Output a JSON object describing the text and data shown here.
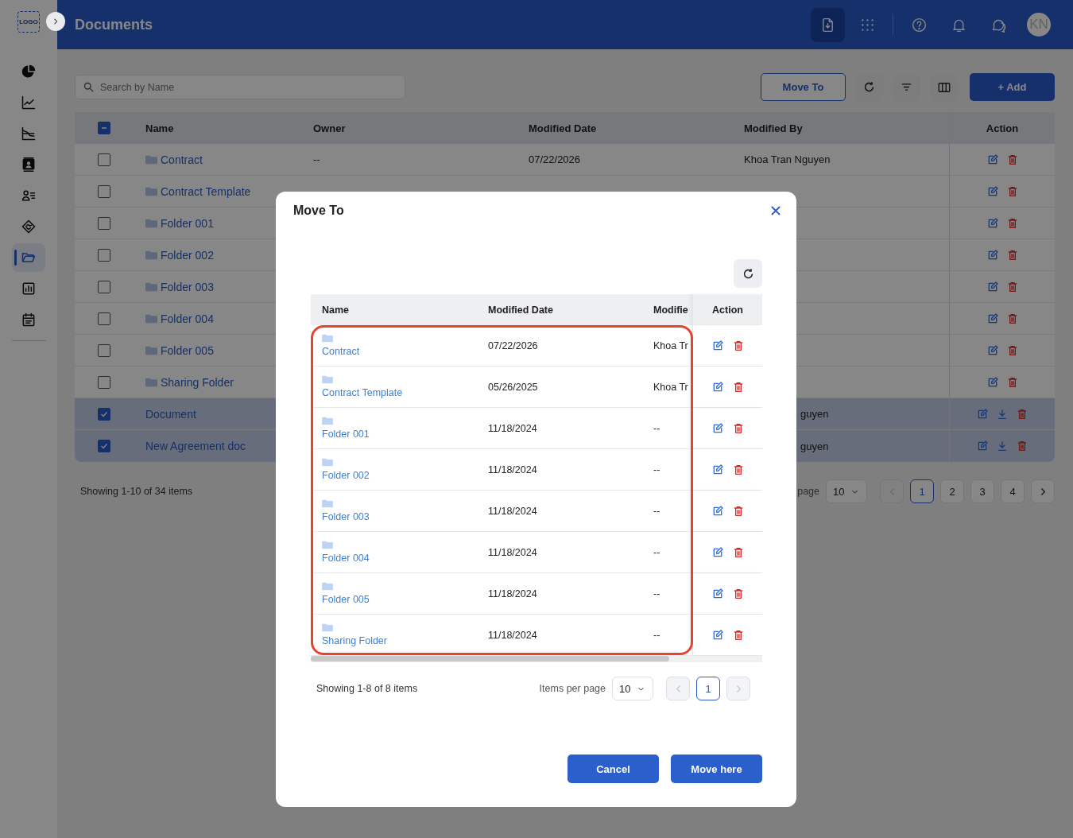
{
  "sidebar": {
    "logo": "LOGO",
    "items": [
      {
        "kind": "pie",
        "selected": false
      },
      {
        "kind": "line",
        "selected": false
      },
      {
        "kind": "trend",
        "selected": false
      },
      {
        "kind": "contacts",
        "selected": false
      },
      {
        "kind": "people",
        "selected": false
      },
      {
        "kind": "deal",
        "selected": false
      },
      {
        "kind": "folder",
        "selected": true
      },
      {
        "kind": "report",
        "selected": false
      },
      {
        "kind": "calendar",
        "selected": false
      }
    ]
  },
  "header": {
    "title": "Documents",
    "avatar": "KN",
    "actions": [
      {
        "kind": "download",
        "selected": true
      },
      {
        "kind": "apps",
        "selected": false
      },
      {
        "kind": "help",
        "selected": false
      },
      {
        "kind": "bell",
        "selected": false
      },
      {
        "kind": "chat",
        "selected": false
      }
    ]
  },
  "toolbar": {
    "search": {
      "placeholder": "Search by Name"
    },
    "move_button": "Move To",
    "add_button": "+ Add"
  },
  "table": {
    "select_all": {
      "checked": true,
      "partial": true
    },
    "columns": [
      "Name",
      "Owner",
      "Modified Date",
      "Modified By",
      "Action"
    ],
    "rows": [
      {
        "kind": "folder",
        "name": "Contract",
        "owner": "--",
        "modified_date": "07/22/2026",
        "modified_by": "Khoa Tran Nguyen",
        "selected": false
      },
      {
        "kind": "folder",
        "name": "Contract Template",
        "selected": false
      },
      {
        "kind": "folder",
        "name": "Folder 001",
        "selected": false
      },
      {
        "kind": "folder",
        "name": "Folder 002",
        "selected": false
      },
      {
        "kind": "folder",
        "name": "Folder 003",
        "selected": false
      },
      {
        "kind": "folder",
        "name": "Folder 004",
        "selected": false
      },
      {
        "kind": "folder",
        "name": "Folder 005",
        "selected": false
      },
      {
        "kind": "folder",
        "name": "Sharing Folder",
        "selected": false
      },
      {
        "kind": "document",
        "name": "Document",
        "modified_by": "guyen",
        "selected": true
      },
      {
        "kind": "document",
        "name": "New Agreement doc",
        "modified_by": "guyen",
        "selected": true
      }
    ]
  },
  "pagination": {
    "summary": "Showing 1-10 of 34 items",
    "per_page_label": "page",
    "per_page": "10",
    "prev_disabled": true,
    "next_disabled": false,
    "pages": [
      {
        "label": "1",
        "selected": true
      },
      {
        "label": "2",
        "selected": false
      },
      {
        "label": "3",
        "selected": false
      },
      {
        "label": "4",
        "selected": false
      }
    ]
  },
  "dialog": {
    "title": "Move To",
    "columns": [
      "Name",
      "Modified Date",
      "Modifie",
      "Action"
    ],
    "rows": [
      {
        "name": "Contract",
        "modified_date": "07/22/2026",
        "modified_by": "Khoa Tr"
      },
      {
        "name": "Contract Template",
        "modified_date": "05/26/2025",
        "modified_by": "Khoa Tr"
      },
      {
        "name": "Folder 001",
        "modified_date": "11/18/2024",
        "modified_by": "--"
      },
      {
        "name": "Folder 002",
        "modified_date": "11/18/2024",
        "modified_by": "--"
      },
      {
        "name": "Folder 003",
        "modified_date": "11/18/2024",
        "modified_by": "--"
      },
      {
        "name": "Folder 004",
        "modified_date": "11/18/2024",
        "modified_by": "--"
      },
      {
        "name": "Folder 005",
        "modified_date": "11/18/2024",
        "modified_by": "--"
      },
      {
        "name": "Sharing Folder",
        "modified_date": "11/18/2024",
        "modified_by": "--"
      }
    ],
    "pagination": {
      "summary": "Showing 1-8 of 8 items",
      "per_page_label": "Items per page",
      "per_page": "10",
      "prev_disabled": true,
      "next_disabled": true,
      "pages": [
        {
          "label": "1",
          "selected": true
        }
      ]
    },
    "buttons": [
      "Cancel",
      "Move here"
    ]
  }
}
